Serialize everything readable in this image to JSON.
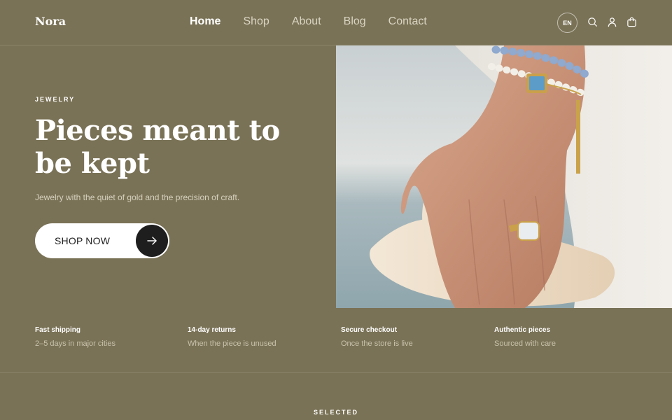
{
  "brand": {
    "name": "Nora"
  },
  "nav": {
    "items": [
      {
        "label": "Home",
        "active": true
      },
      {
        "label": "Shop",
        "active": false
      },
      {
        "label": "About",
        "active": false
      },
      {
        "label": "Blog",
        "active": false
      },
      {
        "label": "Contact",
        "active": false
      }
    ]
  },
  "header": {
    "language": "EN",
    "icons": [
      "search-icon",
      "user-icon",
      "cart-icon"
    ]
  },
  "hero": {
    "eyebrow": "JEWELRY",
    "title": "Pieces meant to be kept",
    "subtitle": "Jewelry with the quiet of gold and the precision of craft.",
    "cta_label": "SHOP NOW"
  },
  "features": [
    {
      "title": "Fast shipping",
      "desc": "2–5 days in major cities"
    },
    {
      "title": "14-day returns",
      "desc": "When the piece is unused"
    },
    {
      "title": "Secure checkout",
      "desc": "Once the store is live"
    },
    {
      "title": "Authentic pieces",
      "desc": "Sourced with care"
    }
  ],
  "section": {
    "eyebrow": "SELECTED"
  },
  "colors": {
    "background": "#7a7256",
    "text": "#ffffff",
    "muted": "#d6d1bf",
    "button_bg": "#ffffff",
    "button_icon_bg": "#1e1e1e"
  }
}
